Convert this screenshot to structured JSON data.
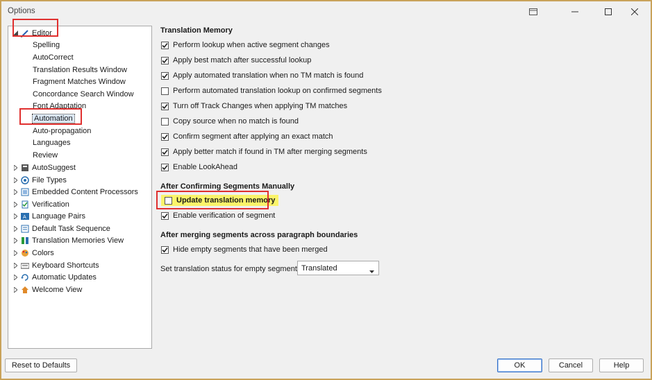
{
  "window": {
    "title": "Options"
  },
  "tree": {
    "editor": "Editor",
    "children": [
      "Spelling",
      "AutoCorrect",
      "Translation Results Window",
      "Fragment Matches Window",
      "Concordance Search Window",
      "Font Adaptation",
      "Automation",
      "Auto-propagation",
      "Languages",
      "Review"
    ],
    "selected": "Automation",
    "top_level": [
      {
        "label": "AutoSuggest",
        "icon": "autosuggest-icon"
      },
      {
        "label": "File Types",
        "icon": "file-types-icon"
      },
      {
        "label": "Embedded Content Processors",
        "icon": "embedded-content-icon"
      },
      {
        "label": "Verification",
        "icon": "verification-icon"
      },
      {
        "label": "Language Pairs",
        "icon": "language-pairs-icon"
      },
      {
        "label": "Default Task Sequence",
        "icon": "task-sequence-icon"
      },
      {
        "label": "Translation Memories View",
        "icon": "tm-view-icon"
      },
      {
        "label": "Colors",
        "icon": "colors-icon"
      },
      {
        "label": "Keyboard Shortcuts",
        "icon": "keyboard-icon"
      },
      {
        "label": "Automatic Updates",
        "icon": "updates-icon"
      },
      {
        "label": "Welcome View",
        "icon": "home-icon"
      }
    ]
  },
  "sections": {
    "translation_memory": {
      "title": "Translation Memory",
      "options": [
        {
          "label": "Perform lookup when active segment changes",
          "checked": true
        },
        {
          "label": "Apply best match after successful lookup",
          "checked": true
        },
        {
          "label": "Apply automated translation when no TM match is found",
          "checked": true
        },
        {
          "label": "Perform automated translation lookup on confirmed segments",
          "checked": false
        },
        {
          "label": "Turn off Track Changes when applying TM matches",
          "checked": true
        },
        {
          "label": "Copy source when no match is found",
          "checked": false
        },
        {
          "label": "Confirm segment after applying an exact match",
          "checked": true
        },
        {
          "label": "Apply better match if found in TM after merging segments",
          "checked": true
        },
        {
          "label": "Enable LookAhead",
          "checked": true
        }
      ]
    },
    "after_confirming": {
      "title": "After Confirming Segments Manually",
      "options": [
        {
          "label": "Update translation memory",
          "checked": false
        },
        {
          "label": "Enable verification of segment",
          "checked": true
        }
      ]
    },
    "after_merging": {
      "title": "After merging segments across paragraph boundaries",
      "options": [
        {
          "label": "Hide empty segments that have been merged",
          "checked": true
        }
      ]
    }
  },
  "status_setting": {
    "label": "Set translation status for empty segments to:",
    "value": "Translated"
  },
  "buttons": {
    "reset": "Reset to Defaults",
    "ok": "OK",
    "cancel": "Cancel",
    "help": "Help"
  },
  "colors": {
    "highlight": "#fbf46a",
    "annotation_red": "#e0302f",
    "selection": "#dbe8f7"
  }
}
